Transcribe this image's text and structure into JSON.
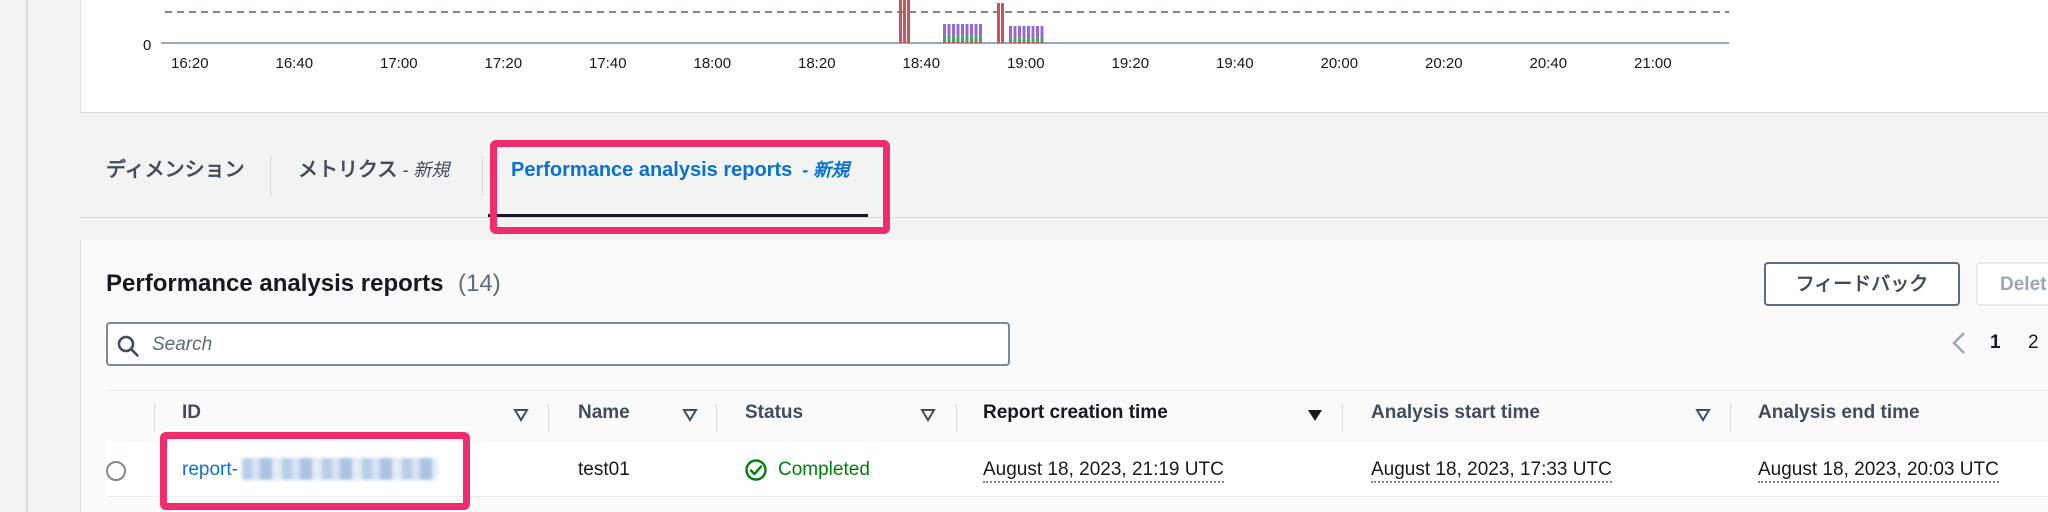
{
  "chart": {
    "y_zero_label": "0",
    "x_ticks": [
      "16:20",
      "16:40",
      "17:00",
      "17:20",
      "17:40",
      "18:00",
      "18:20",
      "18:40",
      "19:00",
      "19:20",
      "19:40",
      "20:00",
      "20:20",
      "20:40",
      "21:00"
    ],
    "colors": {
      "bar_red": "#c9545a",
      "bar_purple": "#9469d6",
      "bar_green": "#48a56d",
      "threshold": "#7d8998"
    }
  },
  "tabs": {
    "dimension": "ディメンション",
    "metrics_label": "メトリクス",
    "metrics_tag": " - 新規",
    "reports_label": "Performance analysis reports",
    "reports_tag": "  - 新規"
  },
  "reports": {
    "title": "Performance analysis reports",
    "count": "(14)",
    "feedback_button": "フィードバック",
    "delete_button": "Delet",
    "search_placeholder": "Search",
    "pagination": {
      "current": "1",
      "next": "2"
    }
  },
  "table": {
    "headers": {
      "id": "ID",
      "name": "Name",
      "status": "Status",
      "report_creation_time": "Report creation time",
      "analysis_start_time": "Analysis start time",
      "analysis_end_time": "Analysis end time"
    },
    "rows": [
      {
        "id_prefix": "report-",
        "name": "test01",
        "status": "Completed",
        "report_creation_time": "August 18, 2023, 21:19 UTC",
        "analysis_start_time": "August 18, 2023, 17:33 UTC",
        "analysis_end_time": "August 18, 2023, 20:03 UTC"
      }
    ]
  },
  "colors": {
    "highlight": "#ee2c6e",
    "link": "#0972d3",
    "success": "#037f0c"
  }
}
